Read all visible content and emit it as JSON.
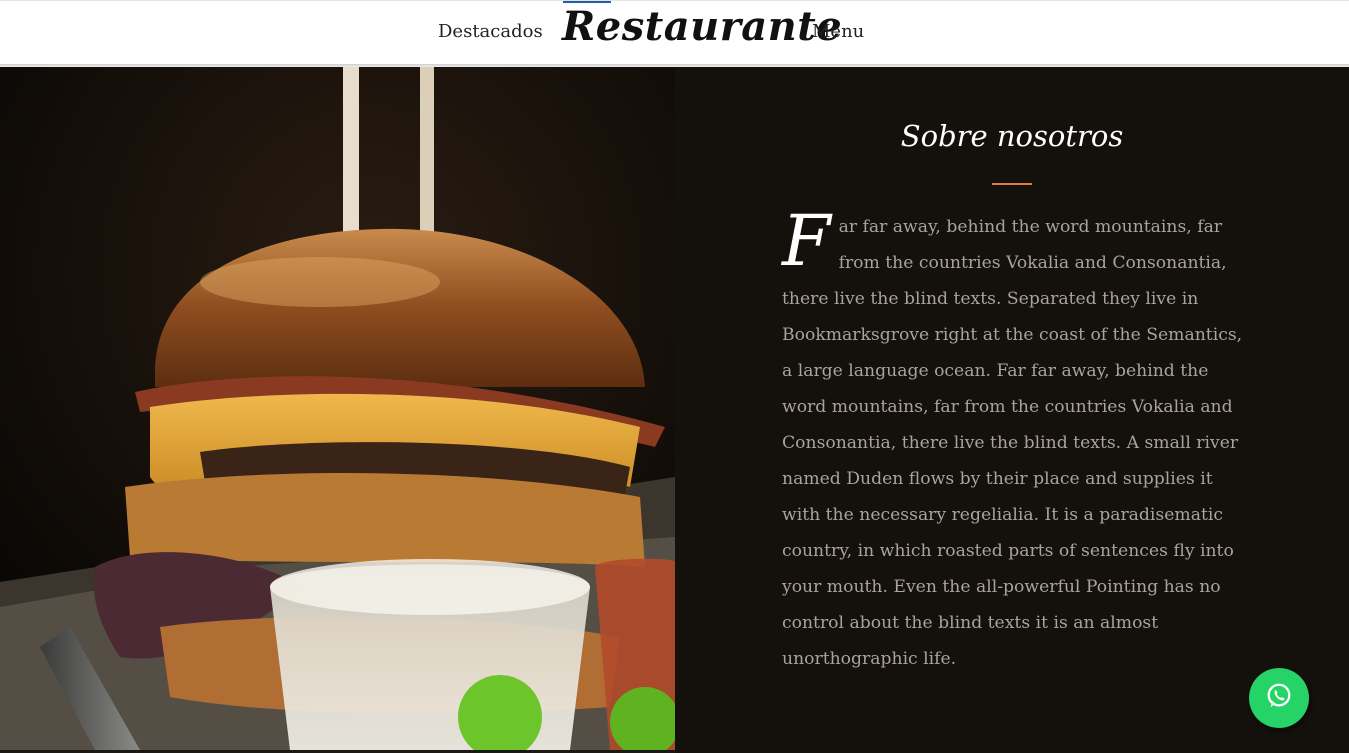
{
  "header": {
    "nav_left": "Destacados",
    "brand": "Restaurante",
    "nav_right": "Menu"
  },
  "hero": {
    "icon": "burger-photo"
  },
  "about": {
    "title": "Sobre nosotros",
    "dropcap": "F",
    "text": "ar far away, behind the word mountains, far from the countries Vokalia and Consonantia, there live the blind texts. Separated they live in Bookmarksgrove right at the coast of the Semantics, a large language ocean. Far far away, behind the word mountains, far from the countries Vokalia and Consonantia, there live the blind texts. A small river named Duden flows by their place and supplies it with the necessary regelialia. It is a paradisematic country, in which roasted parts of sentences fly into your mouth. Even the all-powerful Pointing has no control about the blind texts it is an almost unorthographic life."
  },
  "whatsapp": {
    "icon": "whatsapp-icon"
  },
  "colors": {
    "accent": "#e07b39",
    "panel_bg": "#14100b",
    "whatsapp": "#25d366",
    "header_accent": "#1f5fa8"
  }
}
